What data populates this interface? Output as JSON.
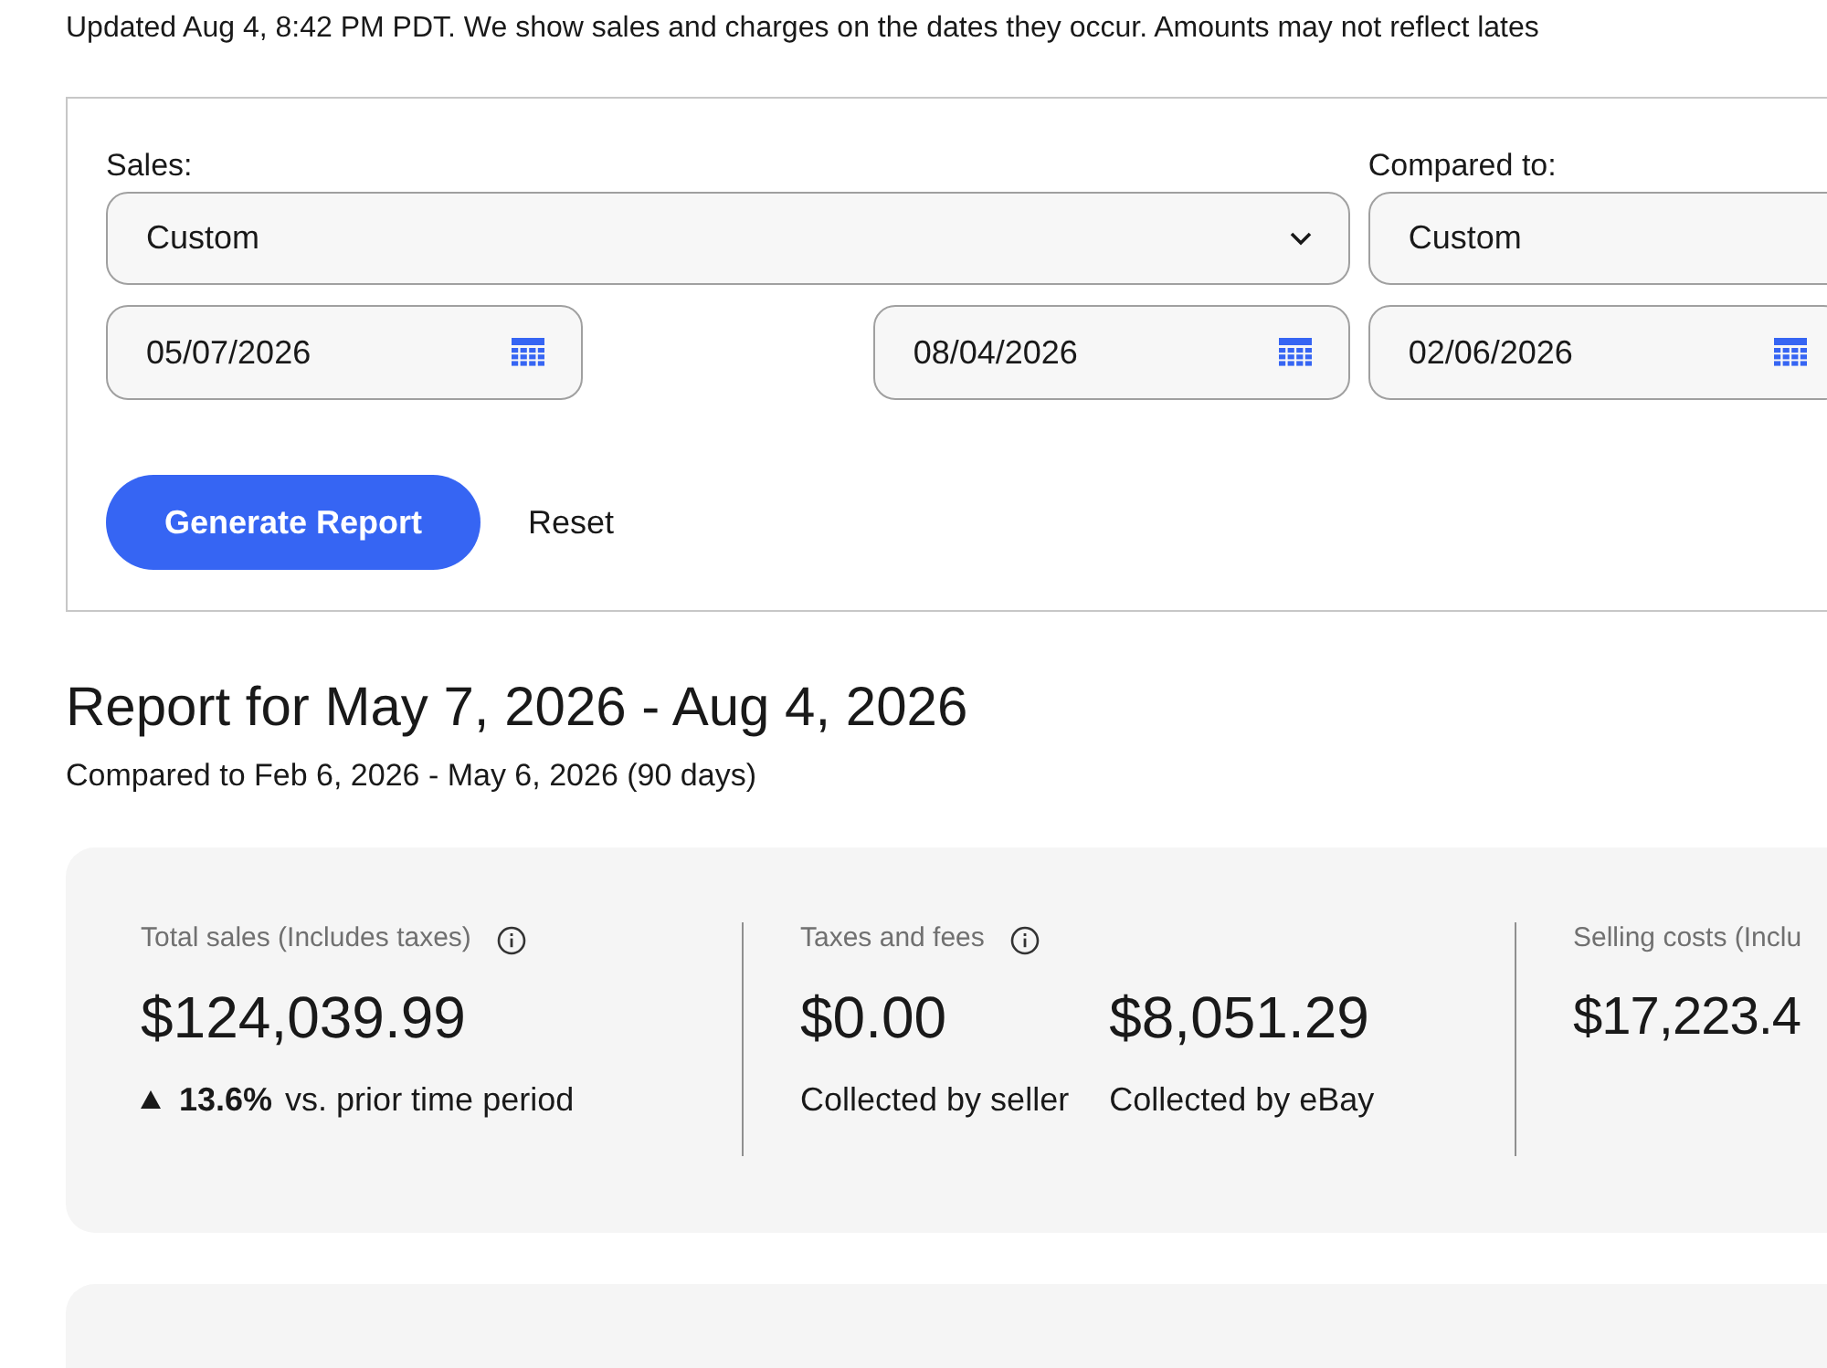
{
  "notice": "Updated Aug 4, 8:42 PM PDT. We show sales and charges on the dates they occur. Amounts may not reflect lates",
  "filters": {
    "sales_label": "Sales:",
    "sales_select": "Custom",
    "compared_label": "Compared to:",
    "compared_select": "Custom",
    "sales_start": "05/07/2026",
    "sales_end": "08/04/2026",
    "compared_start": "02/06/2026"
  },
  "actions": {
    "generate": "Generate Report",
    "reset": "Reset"
  },
  "report": {
    "title": "Report for May 7, 2026 - Aug 4, 2026",
    "subtitle": "Compared to Feb 6, 2026 - May 6, 2026 (90 days)"
  },
  "metrics": [
    {
      "kind": "change",
      "label": "Total sales (Includes taxes)",
      "info": true,
      "value": "$124,039.99",
      "change": "13.6%",
      "change_text": "vs. prior time period"
    },
    {
      "kind": "split",
      "label": "Taxes and fees",
      "info": true,
      "parts": [
        {
          "value": "$0.00",
          "caption": "Collected by seller"
        },
        {
          "value": "$8,051.29",
          "caption": "Collected by eBay"
        }
      ]
    },
    {
      "kind": "plain",
      "label": "Selling costs (Inclu",
      "value": "$17,223.4"
    }
  ]
}
